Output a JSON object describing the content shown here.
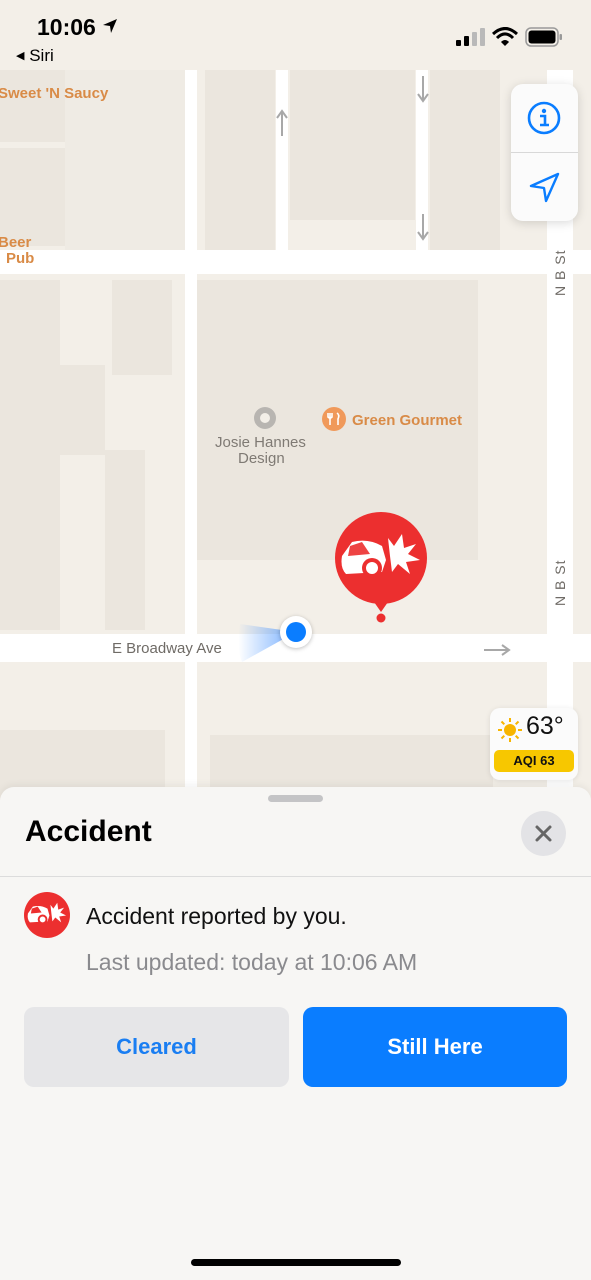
{
  "status_bar": {
    "time": "10:06",
    "back_label": "Siri"
  },
  "map": {
    "pois": {
      "sweet_n_saucy": "Sweet 'N Saucy",
      "beer_pub_line1": "Beer",
      "beer_pub_line2": "Pub",
      "green_gourmet": "Green Gourmet",
      "josie_line1": "Josie Hannes",
      "josie_line2": "Design"
    },
    "streets": {
      "e_broadway": "E Broadway Ave",
      "n_b_st": "N B St"
    },
    "controls": [
      "info-icon",
      "location-arrow-icon"
    ],
    "weather": {
      "temp": "63°",
      "aqi": "AQI 63"
    },
    "colors": {
      "accident_red": "#ec2f2f",
      "user_blue": "#0a7dff",
      "poi_orange": "#d98b47"
    }
  },
  "sheet": {
    "title": "Accident",
    "report_text": "Accident reported by you.",
    "updated_text": "Last updated: today at 10:06 AM",
    "cleared_label": "Cleared",
    "still_here_label": "Still Here"
  }
}
